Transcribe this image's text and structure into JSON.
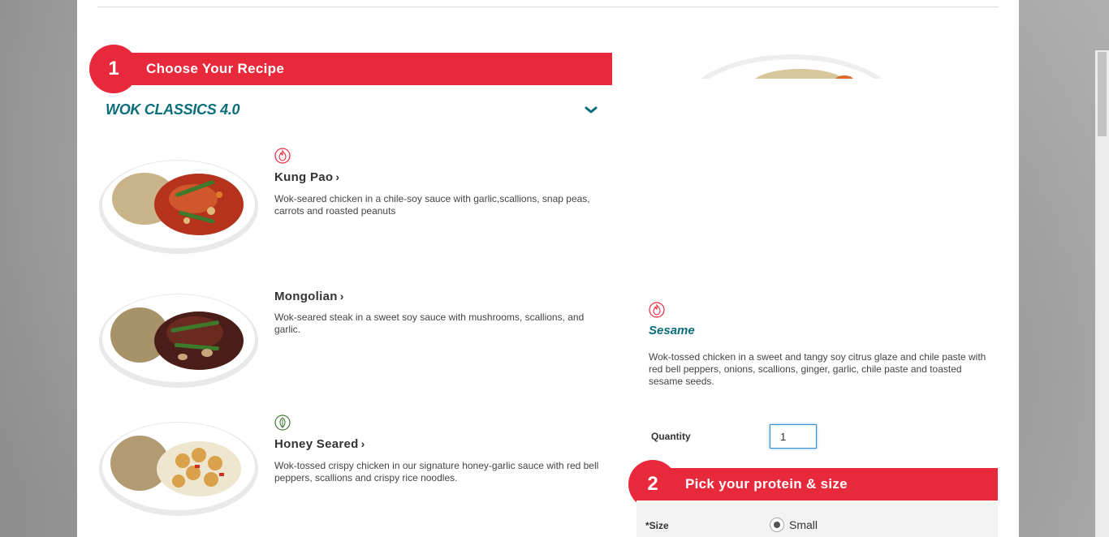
{
  "step1": {
    "number": "1",
    "title": "Choose Your Recipe"
  },
  "category": {
    "title": "WOK CLASSICS 4.0"
  },
  "recipes": [
    {
      "icon": "spicy-flame-icon",
      "name": "Kung Pao",
      "arrow": "›",
      "description": "Wok-seared chicken in a chile-soy sauce with garlic,scallions, snap peas, carrots and roasted peanuts"
    },
    {
      "icon": "",
      "name": "Mongolian",
      "arrow": "›",
      "description": "Wok-seared steak in a sweet soy sauce with mushrooms, scallions, and garlic."
    },
    {
      "icon": "vegetarian-leaf-icon",
      "name": "Honey Seared",
      "arrow": "›",
      "description": "Wok-tossed crispy chicken in our signature honey-garlic sauce with red bell peppers, scallions and crispy rice noodles."
    }
  ],
  "selected": {
    "icon": "spicy-flame-icon",
    "name": "Sesame",
    "description": "Wok-tossed chicken in a sweet and tangy soy citrus glaze and chile paste with red bell peppers, onions, scallions, ginger, garlic, chile paste and toasted sesame seeds."
  },
  "quantity": {
    "label": "Quantity",
    "value": "1"
  },
  "step2": {
    "number": "2",
    "title": "Pick your protein & size"
  },
  "size": {
    "label": "*Size",
    "option": "Small"
  },
  "colors": {
    "brand_red": "#e8293b",
    "teal": "#0b6e7a"
  }
}
